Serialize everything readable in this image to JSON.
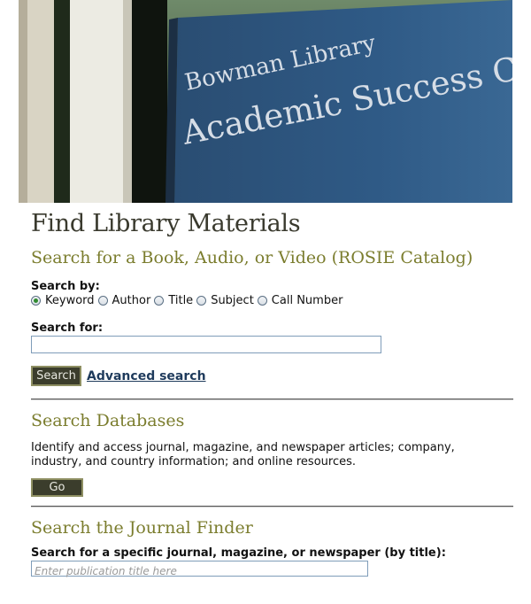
{
  "banner": {
    "line1": "Bowman Library",
    "line2": "Academic Success Center"
  },
  "page_title": "Find Library Materials",
  "catalog": {
    "title": "Search for a Book, Audio, or Video (ROSIE Catalog)",
    "search_by_label": "Search by:",
    "options": [
      "Keyword",
      "Author",
      "Title",
      "Subject",
      "Call Number"
    ],
    "selected": "Keyword",
    "search_for_label": "Search for:",
    "search_value": "",
    "search_button": "Search",
    "advanced_link": "Advanced search"
  },
  "databases": {
    "title": "Search Databases",
    "description": "Identify and access journal, magazine, and newspaper articles; company, industry, and country information; and online resources.",
    "go_button": "Go"
  },
  "journal_finder": {
    "title": "Search the Journal Finder",
    "label": "Search for a specific journal, magazine, or newspaper (by title):",
    "placeholder": "Enter publication title here"
  },
  "colors": {
    "section_title": "#7b7d2e",
    "button_bg": "#3b3d2c",
    "link": "#1f3b5c"
  }
}
